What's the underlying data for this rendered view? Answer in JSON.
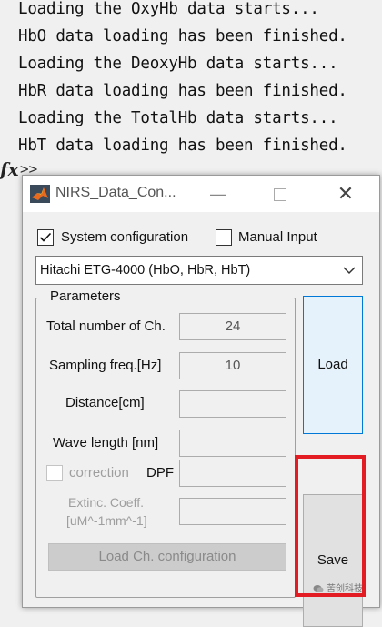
{
  "console": {
    "lines": [
      "Loading the OxyHb data starts...",
      "HbO data loading has been finished.",
      "Loading the DeoxyHb data starts...",
      "HbR data loading has been finished.",
      "Loading the TotalHb data starts...",
      "HbT data loading has been finished."
    ],
    "fx_symbol": "fx",
    "prompt": ">>"
  },
  "dialog": {
    "title": "NIRS_Data_Con...",
    "window_buttons": {
      "minimize": "—",
      "close": "✕"
    },
    "system_config": {
      "label": "System configuration",
      "checked": true
    },
    "manual_input": {
      "label": "Manual Input",
      "checked": false
    },
    "system_select": {
      "value": "Hitachi ETG-4000 (HbO, HbR, HbT)"
    },
    "parameters": {
      "title": "Parameters",
      "total_channels": {
        "label": "Total number of Ch.",
        "value": "24"
      },
      "sampling_freq": {
        "label": "Sampling freq.[Hz]",
        "value": "10"
      },
      "distance": {
        "label": "Distance[cm]",
        "value": ""
      },
      "wave_length": {
        "label": "Wave length [nm]",
        "value": ""
      },
      "correction": {
        "label": "correction",
        "checked": false
      },
      "dpf": {
        "label": "DPF",
        "value": ""
      },
      "extinction": {
        "label_line1": "Extinc. Coeff.",
        "label_line2": "[uM^-1mm^-1]",
        "value": ""
      },
      "load_ch_button": "Load Ch. configuration"
    },
    "load_button": "Load",
    "save_button": "Save"
  },
  "watermark": {
    "text": "苦创科技"
  },
  "colors": {
    "highlight": "#e31b23",
    "accent": "#0078d7"
  }
}
